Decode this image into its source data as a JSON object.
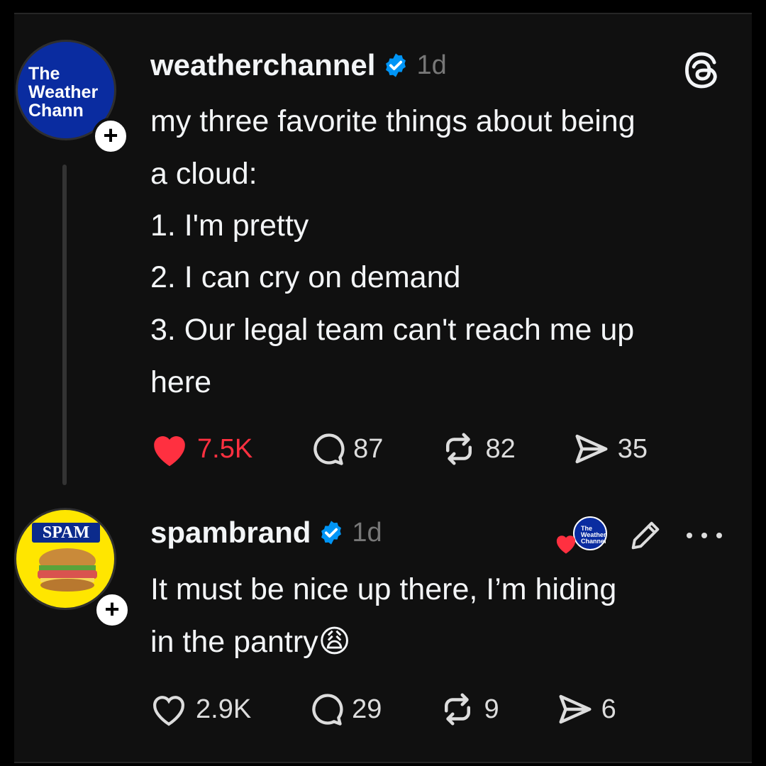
{
  "post1": {
    "avatar_text": [
      "The",
      "Weather",
      "Chann"
    ],
    "username": "weatherchannel",
    "time": "1d",
    "lines": [
      "my three favorite things about being\na cloud:",
      "1. I'm pretty",
      "2. I can cry on demand",
      "3. Our legal team can't reach me up\nhere"
    ],
    "likes": "7.5K",
    "replies": "87",
    "reposts": "82",
    "shares": "35",
    "liked": true
  },
  "post2": {
    "avatar_text": "SPAM",
    "username": "spambrand",
    "time": "1d",
    "text": "It must be nice up there, I’m hiding\nin the pantry",
    "emoji": "😩",
    "likes": "2.9K",
    "replies": "29",
    "reposts": "9",
    "shares": "6",
    "liked_by_author_avatar_text": [
      "The",
      "Weather",
      "Channel"
    ]
  },
  "icons": {
    "app_logo": "threads-logo-icon",
    "verified": "verified-badge-icon",
    "like": "heart-icon",
    "reply": "comment-icon",
    "repost": "repost-icon",
    "share": "send-icon",
    "edit": "pencil-icon",
    "more": "more-icon"
  },
  "colors": {
    "background": "#101010",
    "verified": "#0095f6",
    "liked": "#ff3040",
    "muted": "#777777"
  }
}
